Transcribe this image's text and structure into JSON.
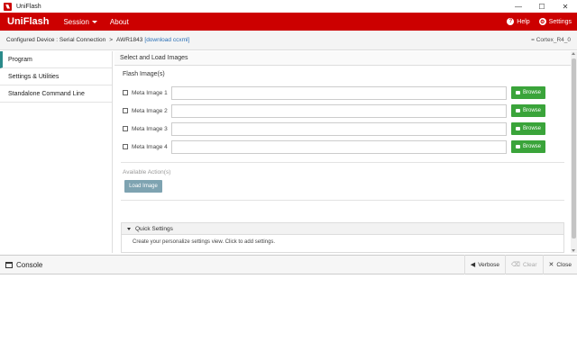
{
  "window": {
    "title": "UniFlash",
    "minimize": "—",
    "maximize": "☐",
    "close": "✕"
  },
  "menubar": {
    "brand": "UniFlash",
    "session": "Session",
    "about": "About",
    "help": "Help",
    "settings": "Settings"
  },
  "device": {
    "label": "Configured Device : Serial Connection",
    "sep": ">",
    "device_name": "AWR1843",
    "download": "[download ccxml]",
    "core": "= Cortex_R4_0"
  },
  "sidebar": {
    "items": [
      {
        "label": "Program"
      },
      {
        "label": "Settings & Utilities"
      },
      {
        "label": "Standalone Command Line"
      }
    ]
  },
  "main": {
    "section_title": "Select and Load Images",
    "flash_title": "Flash Image(s)",
    "images": [
      {
        "label": "Meta Image 1",
        "value": ""
      },
      {
        "label": "Meta Image 2",
        "value": ""
      },
      {
        "label": "Meta Image 3",
        "value": ""
      },
      {
        "label": "Meta Image 4",
        "value": ""
      }
    ],
    "browse_label": "Browse",
    "actions_title": "Available Action(s)",
    "load_button": "Load Image",
    "quick_settings_title": "Quick Settings",
    "quick_settings_body": "Create your personalize settings view. Click to add settings."
  },
  "console": {
    "title": "Console",
    "verbose": "Verbose",
    "clear": "Clear",
    "close": "Close"
  }
}
